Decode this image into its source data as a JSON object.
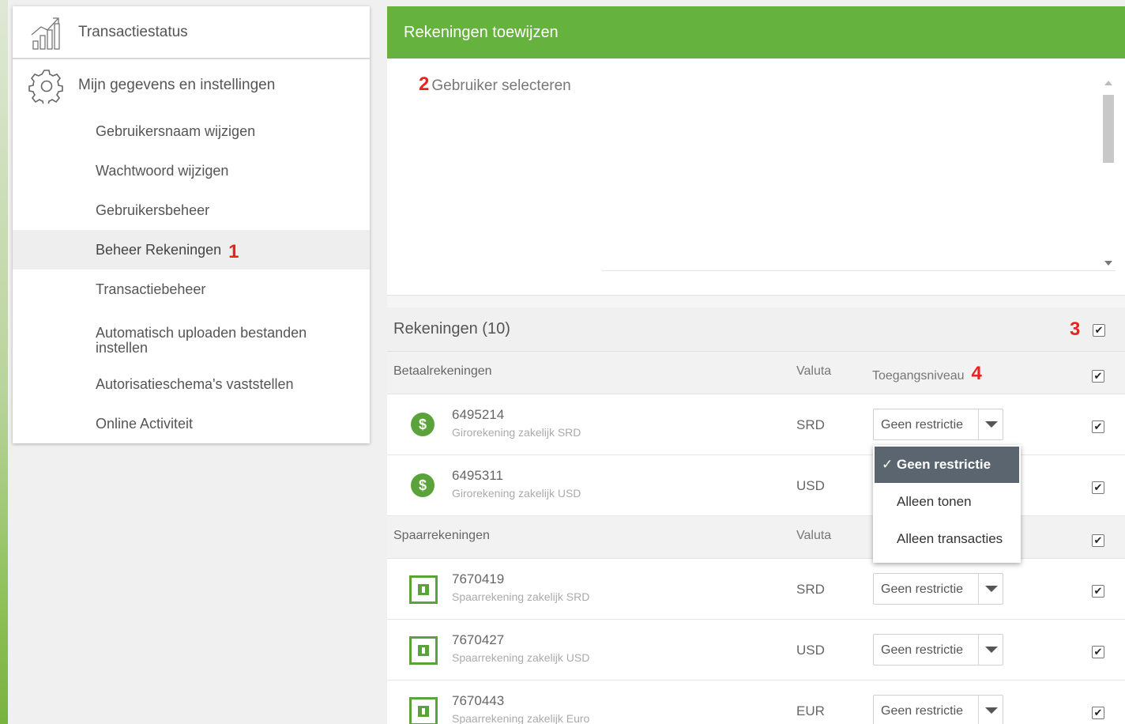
{
  "sidebar": {
    "transaction_status": "Transactiestatus",
    "settings_header": "Mijn gegevens en instellingen",
    "items": [
      {
        "label": "Gebruikersnaam wijzigen"
      },
      {
        "label": "Wachtwoord wijzigen"
      },
      {
        "label": "Gebruikersbeheer"
      },
      {
        "label": "Beheer Rekeningen",
        "marker": "1"
      },
      {
        "label": "Transactiebeheer"
      },
      {
        "label": "Automatisch uploaden bestanden instellen"
      },
      {
        "label": "Autorisatieschema's vaststellen"
      },
      {
        "label": "Online Activiteit"
      }
    ]
  },
  "panel": {
    "title": "Rekeningen toewijzen",
    "user_select_marker": "2",
    "user_select_label": "Gebruiker selecteren",
    "accounts_title": "Rekeningen (10)",
    "select_all_marker": "3",
    "access_marker": "4"
  },
  "sections": [
    {
      "title": "Betaalrekeningen",
      "currency_col": "Valuta",
      "access_col": "Toegangsniveau",
      "rows": [
        {
          "number": "6495214",
          "desc": "Girorekening zakelijk SRD",
          "currency": "SRD",
          "access": "Geen restrictie",
          "icon": "dollar-icon"
        },
        {
          "number": "6495311",
          "desc": "Girorekening zakelijk USD",
          "currency": "USD",
          "access": "Geen restrictie",
          "icon": "dollar-icon"
        }
      ]
    },
    {
      "title": "Spaarrekeningen",
      "currency_col": "Valuta",
      "rows": [
        {
          "number": "7670419",
          "desc": "Spaarrekening zakelijk SRD",
          "currency": "SRD",
          "access": "Geen restrictie",
          "icon": "safe-icon"
        },
        {
          "number": "7670427",
          "desc": "Spaarrekening zakelijk USD",
          "currency": "USD",
          "access": "Geen restrictie",
          "icon": "safe-icon"
        },
        {
          "number": "7670443",
          "desc": "Spaarrekening zakelijk Euro",
          "currency": "EUR",
          "access": "Geen restrictie",
          "icon": "safe-icon"
        }
      ]
    }
  ],
  "dropdown_menu": {
    "check": "✓",
    "options": [
      "Geen restrictie",
      "Alleen tonen",
      "Alleen transacties"
    ],
    "selected": "Geen restrictie"
  },
  "colors": {
    "header_green": "#66b23e",
    "icon_green": "#5aa23a",
    "marker_red": "#e8231f",
    "selected_option": "#5a6570"
  },
  "checkbox_mark": "✔"
}
